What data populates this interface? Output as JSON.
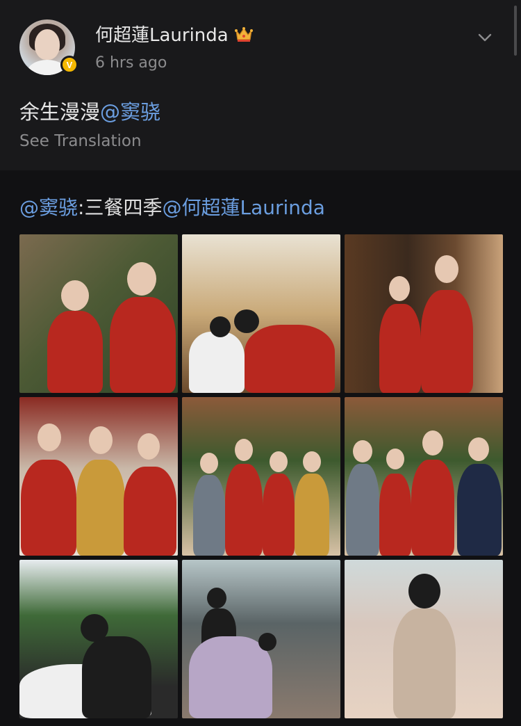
{
  "post": {
    "username": "何超蓮Laurinda",
    "timestamp": "6 hrs ago",
    "text_before": "余生漫漫",
    "text_mention": "@窦骁",
    "see_translation": "See Translation",
    "verified_badge": "V"
  },
  "repost": {
    "mention_author": "@窦骁",
    "separator": ":",
    "text": "三餐四季",
    "mention_tail": "@何超蓮Laurinda"
  },
  "icons": {
    "crown": "crown-icon",
    "chevron": "chevron-down-icon",
    "verified": "verified-badge-icon"
  },
  "colors": {
    "background": "#141416",
    "header_background": "#19191b",
    "mention": "#6b9ee0",
    "muted_text": "#8c8c8e",
    "verified": "#f5b800"
  }
}
